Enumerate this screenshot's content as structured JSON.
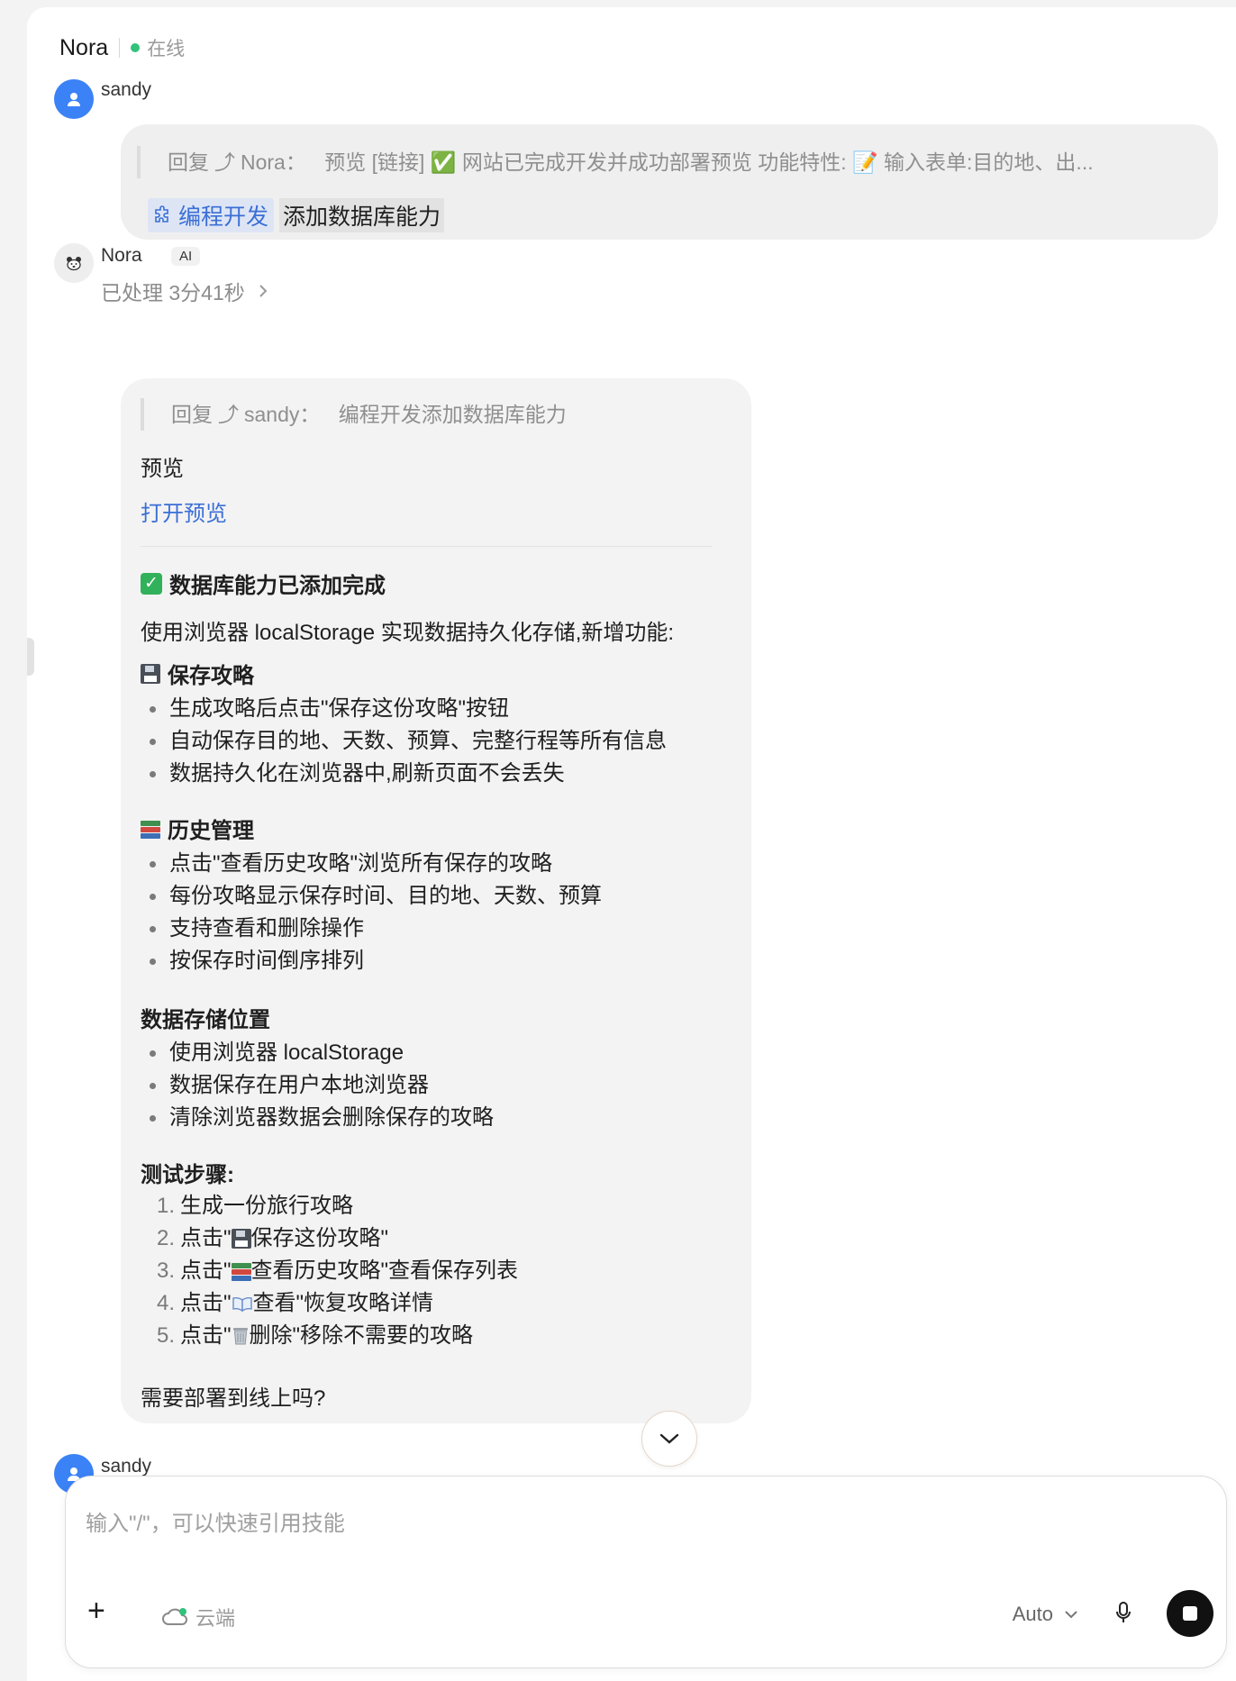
{
  "header": {
    "name": "Nora",
    "status": "在线"
  },
  "messages": {
    "user1": {
      "sender": "sandy",
      "quote_prefix": "回复",
      "quote_target": "Nora：",
      "quote_text": "预览 [链接] ✅ 网站已完成开发并成功部署预览 功能特性: 📝 输入表单:目的地、出...",
      "skill_label": "编程开发",
      "skill_text": "添加数据库能力"
    },
    "bot": {
      "sender": "Nora",
      "badge": "AI",
      "processing": "已处理 3分41秒",
      "quote_prefix": "回复",
      "quote_target": "sandy：",
      "quote_text": "编程开发添加数据库能力",
      "preview_title": "预览",
      "preview_link": "打开预览",
      "done_heading": "数据库能力已添加完成",
      "intro": "使用浏览器 localStorage 实现数据持久化存储,新增功能:",
      "save_heading": "保存攻略",
      "save_items": [
        "生成攻略后点击\"保存这份攻略\"按钮",
        "自动保存目的地、天数、预算、完整行程等所有信息",
        "数据持久化在浏览器中,刷新页面不会丢失"
      ],
      "history_heading": "历史管理",
      "history_items": [
        "点击\"查看历史攻略\"浏览所有保存的攻略",
        "每份攻略显示保存时间、目的地、天数、预算",
        "支持查看和删除操作",
        "按保存时间倒序排列"
      ],
      "storage_heading": "数据存储位置",
      "storage_items": [
        "使用浏览器 localStorage",
        "数据保存在用户本地浏览器",
        "清除浏览器数据会删除保存的攻略"
      ],
      "test_heading": "测试步骤:",
      "test_steps": [
        {
          "num": "1.",
          "pre": "生成一份旅行攻略",
          "icon": "",
          "post": ""
        },
        {
          "num": "2.",
          "pre": "点击\"",
          "icon": "floppy-disk-icon",
          "post": " 保存这份攻略\""
        },
        {
          "num": "3.",
          "pre": "点击\"",
          "icon": "books-icon",
          "post": " 查看历史攻略\"查看保存列表"
        },
        {
          "num": "4.",
          "pre": "点击\"",
          "icon": "open-book-icon",
          "post": " 查看\"恢复攻略详情"
        },
        {
          "num": "5.",
          "pre": "点击\"",
          "icon": "trash-icon",
          "post": " 删除\"移除不需要的攻略"
        }
      ],
      "closing": "需要部署到线上吗?"
    },
    "user2": {
      "sender": "sandy"
    }
  },
  "composer": {
    "placeholder": "输入\"/\"，可以快速引用技能",
    "cloud_label": "云端",
    "mode": "Auto"
  },
  "colors": {
    "accent_blue": "#3b6fd6",
    "online_green": "#31c27c",
    "user_avatar": "#3b82f6"
  }
}
